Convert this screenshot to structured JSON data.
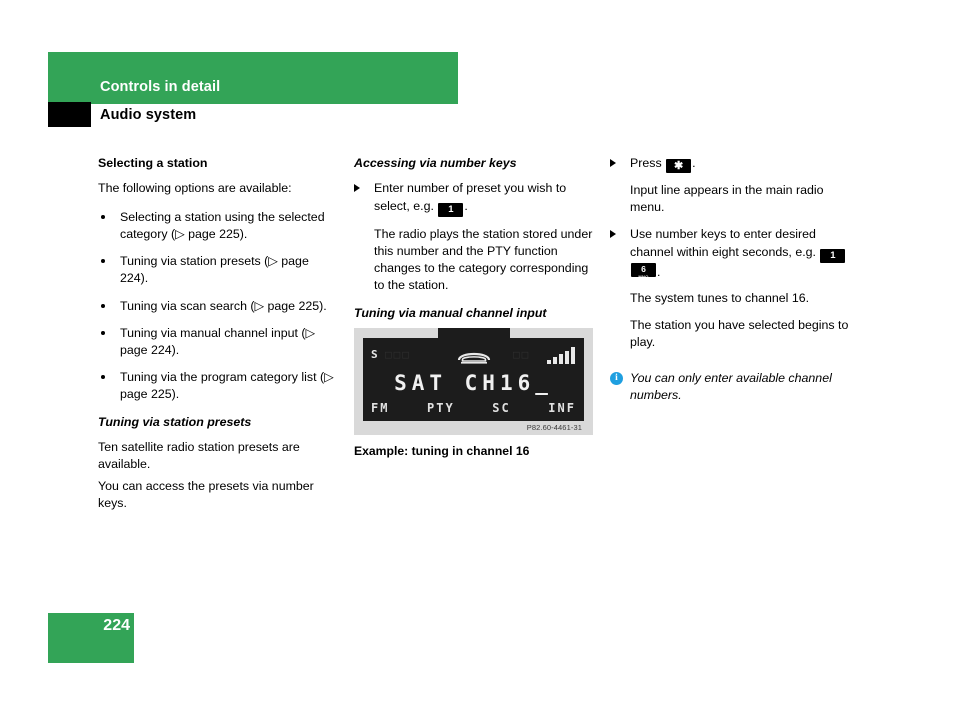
{
  "header": {
    "chapter": "Controls in detail",
    "section": "Audio system"
  },
  "footer": {
    "page_number": "224"
  },
  "colors": {
    "brand_green": "#33a457",
    "info_blue": "#1f9fe0",
    "lcd_background": "#1c1c1c"
  },
  "column1": {
    "heading": "Selecting a station",
    "intro": "The following options are available:",
    "bullets": [
      "Selecting a station using the selected category (▷ page 225).",
      "Tuning via station presets (▷ page 224).",
      "Tuning via scan search (▷ page 225).",
      "Tuning via manual channel input (▷ page 224).",
      "Tuning via the program category list (▷ page 225)."
    ],
    "subheading": "Tuning via station presets",
    "body_line1": "Ten satellite radio station presets are available.",
    "body_line2": "You can access the presets via number keys."
  },
  "column2": {
    "heading": "Accessing via number keys",
    "step1_text_before": "Enter number of preset you wish to select, e.g.",
    "step1_key": "1",
    "step1_text_after": ".",
    "step1_result": "The radio plays the station stored under this number and the PTY function changes to the category corresponding to the station.",
    "subheading": "Tuning via manual channel input"
  },
  "figure": {
    "lcd": {
      "status_left": "S",
      "ghost_left": "□□□",
      "ghost_right": "□□",
      "phone_icon": "phone-handset-icon",
      "signal_icon": "signal-bars-icon",
      "signal_bars": 5,
      "main_text": "SAT CH16_",
      "softkeys": [
        "FM",
        "PTY",
        "SC",
        "INF"
      ]
    },
    "code": "P82.60-4461-31",
    "caption": "Example: tuning in channel 16"
  },
  "column3": {
    "step1_before": "Press",
    "step1_key": "✱",
    "step1_after": ".",
    "step1_result": "Input line appears in the main radio menu.",
    "step2_text": "Use number keys to enter desired channel within eight seconds, e.g.",
    "step2_key_a": "1",
    "step2_key_b_main": "6",
    "step2_key_b_sub": "MNO",
    "step2_after": ".",
    "step2_result_a": "The system tunes to channel 16.",
    "step2_result_b": "The station you have selected begins to play.",
    "note_icon": "i",
    "note_text": "You can only enter available channel numbers."
  }
}
